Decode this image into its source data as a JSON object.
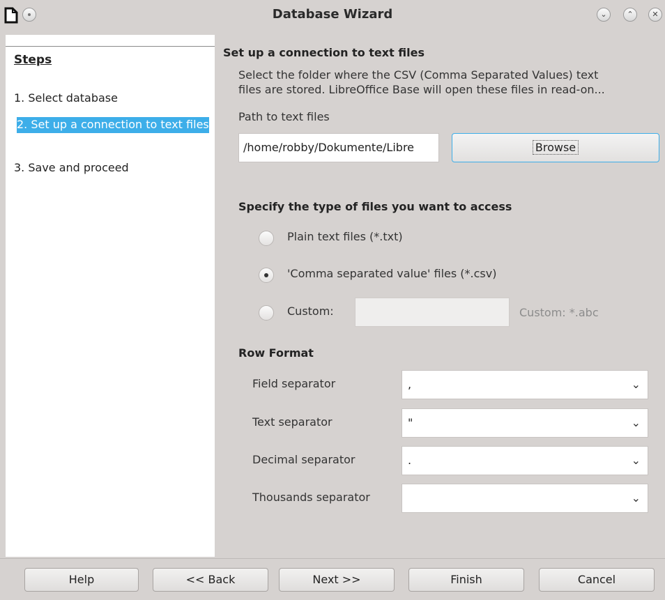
{
  "window": {
    "title": "Database Wizard",
    "controls": [
      "minimize-icon",
      "maximize-icon",
      "close-icon"
    ]
  },
  "steps": {
    "title": "Steps",
    "items": [
      {
        "label": "1. Select database",
        "active": false
      },
      {
        "label": "2. Set up a connection to text files",
        "active": true
      },
      {
        "label": "3. Save and proceed",
        "active": false
      }
    ]
  },
  "main": {
    "title": "Set up a connection to text files",
    "description_line1": "Select the folder where the CSV (Comma Separated Values) text",
    "description_line2": "files are stored. LibreOffice Base will open these files in read-on...",
    "path_label": "Path to text files",
    "path_value": "/home/robby/Dokumente/Libre",
    "browse_label": "Browse",
    "file_type_title": "Specify the type of files you want to access",
    "file_types": [
      {
        "label": "Plain text files (*.txt)",
        "checked": false
      },
      {
        "label": "'Comma separated value' files (*.csv)",
        "checked": true
      },
      {
        "label": "Custom:",
        "checked": false
      }
    ],
    "custom_value": "",
    "custom_hint": "Custom: *.abc",
    "row_format_title": "Row Format",
    "row_format": [
      {
        "label": "Field separator",
        "value": ","
      },
      {
        "label": "Text separator",
        "value": "\""
      },
      {
        "label": "Decimal separator",
        "value": "."
      },
      {
        "label": "Thousands separator",
        "value": ""
      }
    ]
  },
  "footer": {
    "help": "Help",
    "back": "<< Back",
    "next": "Next >>",
    "finish": "Finish",
    "cancel": "Cancel"
  },
  "colors": {
    "accent": "#3daee9",
    "window_bg": "#d6d2d0"
  }
}
